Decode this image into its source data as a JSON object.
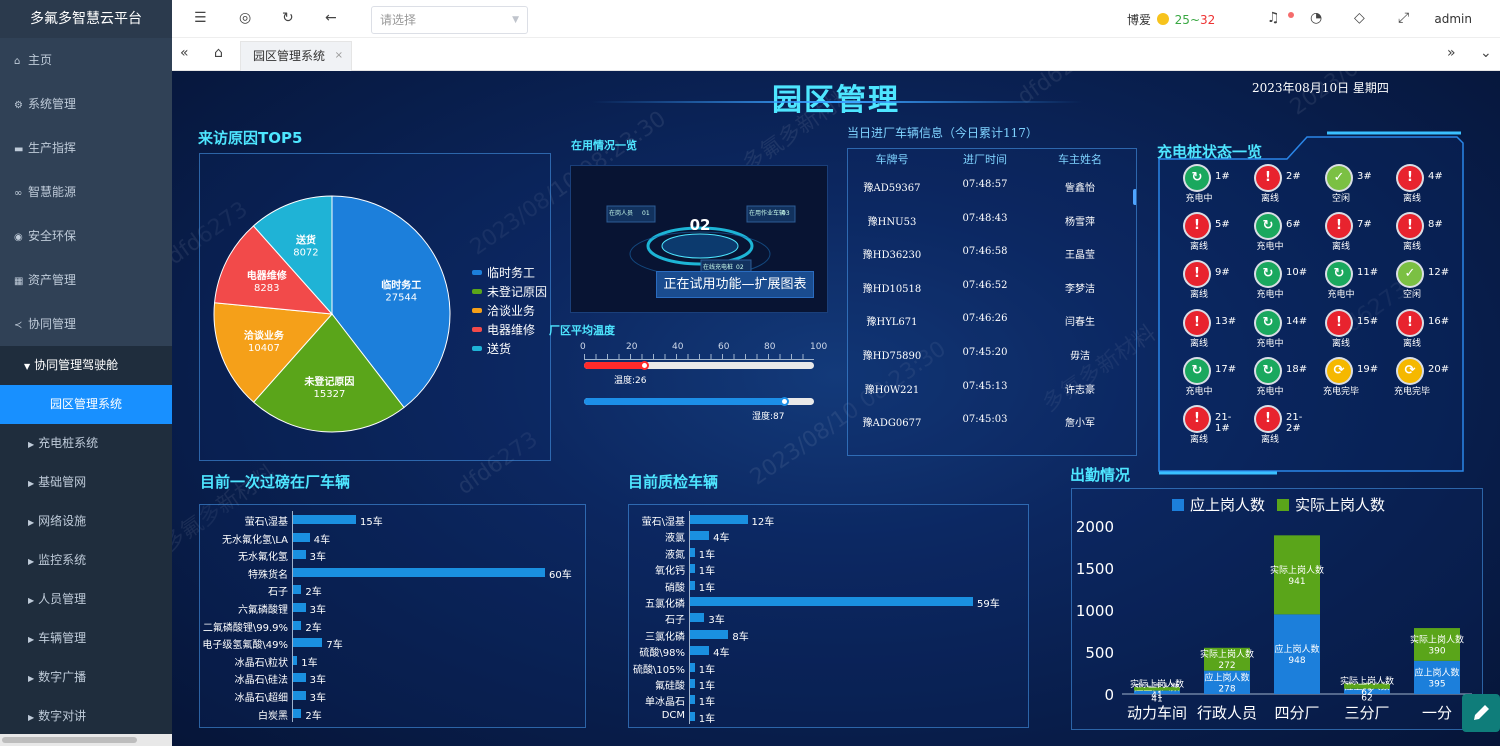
{
  "app": {
    "brand": "多氟多智慧云平台"
  },
  "sidebar": {
    "items": [
      {
        "label": "主页",
        "icon": "⌂"
      },
      {
        "label": "系统管理",
        "icon": "⚙"
      },
      {
        "label": "生产指挥",
        "icon": "▬"
      },
      {
        "label": "智慧能源",
        "icon": "∞"
      },
      {
        "label": "安全环保",
        "icon": "◉"
      },
      {
        "label": "资产管理",
        "icon": "▦"
      },
      {
        "label": "协同管理",
        "icon": "≺"
      }
    ],
    "sub_parent": "协同管理驾驶舱",
    "sub_active": "园区管理系统",
    "sub_items": [
      "充电桩系统",
      "基础管网",
      "网络设施",
      "监控系统",
      "人员管理",
      "车辆管理",
      "数字广播",
      "数字对讲"
    ]
  },
  "header": {
    "select_placeholder": "请选择",
    "weather_city": "博爱",
    "temp_low": "25",
    "temp_sep": "~",
    "temp_high": "32",
    "user": "admin"
  },
  "tabs": {
    "active": "园区管理系统",
    "close": "×"
  },
  "dashboard": {
    "title": "园区管理",
    "date": "2023年08月10日  星期四",
    "watermarks": [
      "dfd6273",
      "2023/08/10 08:23:30",
      "多氟多新材料"
    ]
  },
  "visit_reasons": {
    "title": "来访原因TOP5",
    "chart_data": {
      "type": "pie",
      "slices": [
        {
          "name": "临时务工",
          "value": 27544,
          "color": "#1c7fdb"
        },
        {
          "name": "未登记原因",
          "value": 15327,
          "color": "#5aa51a"
        },
        {
          "name": "洽谈业务",
          "value": 10407,
          "color": "#f5a019"
        },
        {
          "name": "电器维修",
          "value": 8283,
          "color": "#f24a4a"
        },
        {
          "name": "送货",
          "value": 8072,
          "color": "#1fb3d6"
        }
      ],
      "legend_position": "right"
    }
  },
  "usage": {
    "title": "在用情况一览",
    "center_value": "02",
    "monitor_labels": [
      "在岗人员",
      "在用作业车辆",
      "在线充电桩"
    ],
    "monitor_values": [
      "01",
      "03",
      "02"
    ],
    "banner": "正在试用功能—扩展图表"
  },
  "temperature": {
    "title": "厂区平均温度",
    "ticks": [
      "0",
      "20",
      "40",
      "60",
      "80",
      "100"
    ],
    "temp_label": "温度:26",
    "humidity_label": "湿度:87",
    "temp_value": 26,
    "humidity_value": 87
  },
  "vehicles": {
    "title": "当日进厂车辆信息（今日累计117）",
    "columns": [
      "车牌号",
      "进厂时间",
      "车主姓名"
    ],
    "rows": [
      [
        "豫AD59367",
        "07:48:57",
        "訾鑫怡"
      ],
      [
        "豫HNU53",
        "07:48:43",
        "杨雪萍"
      ],
      [
        "豫HD36230",
        "07:46:58",
        "王晶莹"
      ],
      [
        "豫HD10518",
        "07:46:52",
        "李梦洁"
      ],
      [
        "豫HYL671",
        "07:46:26",
        "闫春生"
      ],
      [
        "豫HD75890",
        "07:45:20",
        "毋洁"
      ],
      [
        "豫H0W221",
        "07:45:13",
        "许志豪"
      ],
      [
        "豫ADG0677",
        "07:45:03",
        "詹小军"
      ]
    ]
  },
  "charging": {
    "title": "充电桩状态一览",
    "piles": [
      {
        "num": "1#",
        "status": "充电中",
        "type": "charging"
      },
      {
        "num": "2#",
        "status": "离线",
        "type": "offline"
      },
      {
        "num": "3#",
        "status": "空闲",
        "type": "idle"
      },
      {
        "num": "4#",
        "status": "离线",
        "type": "offline"
      },
      {
        "num": "5#",
        "status": "离线",
        "type": "offline"
      },
      {
        "num": "6#",
        "status": "充电中",
        "type": "charging"
      },
      {
        "num": "7#",
        "status": "离线",
        "type": "offline"
      },
      {
        "num": "8#",
        "status": "离线",
        "type": "offline"
      },
      {
        "num": "9#",
        "status": "离线",
        "type": "offline"
      },
      {
        "num": "10#",
        "status": "充电中",
        "type": "charging"
      },
      {
        "num": "11#",
        "status": "充电中",
        "type": "charging"
      },
      {
        "num": "12#",
        "status": "空闲",
        "type": "idle"
      },
      {
        "num": "13#",
        "status": "离线",
        "type": "offline"
      },
      {
        "num": "14#",
        "status": "充电中",
        "type": "charging"
      },
      {
        "num": "15#",
        "status": "离线",
        "type": "offline"
      },
      {
        "num": "16#",
        "status": "离线",
        "type": "offline"
      },
      {
        "num": "17#",
        "status": "充电中",
        "type": "charging"
      },
      {
        "num": "18#",
        "status": "充电中",
        "type": "charging"
      },
      {
        "num": "19#",
        "status": "充电完毕",
        "type": "done"
      },
      {
        "num": "20#",
        "status": "充电完毕",
        "type": "done"
      },
      {
        "num": "21-1#",
        "status": "离线",
        "type": "offline"
      },
      {
        "num": "21-2#",
        "status": "离线",
        "type": "offline"
      }
    ]
  },
  "weighing": {
    "title": "目前一次过磅在厂车辆",
    "unit": "车",
    "chart_data": {
      "type": "bar",
      "orientation": "horizontal",
      "categories": [
        "萤石\\湿基",
        "无水氟化氢\\LA",
        "无水氟化氢",
        "特殊货名",
        "石子",
        "六氟磷酸锂",
        "二氟磷酸锂\\99.9%",
        "电子级氢氟酸\\49%",
        "冰晶石\\粒状",
        "冰晶石\\硅法",
        "冰晶石\\超细",
        "白炭黑"
      ],
      "values": [
        15,
        4,
        3,
        60,
        2,
        3,
        2,
        7,
        1,
        3,
        3,
        2
      ],
      "xlim": [
        0,
        60
      ]
    }
  },
  "inspection": {
    "title": "目前质检车辆",
    "unit": "车",
    "chart_data": {
      "type": "bar",
      "orientation": "horizontal",
      "categories": [
        "萤石\\湿基",
        "液氯",
        "液氮",
        "氧化钙",
        "硝酸",
        "五氯化磷",
        "石子",
        "三氯化磷",
        "硫酸\\98%",
        "硫酸\\105%",
        "氟硅酸",
        "单冰晶石",
        "DCM"
      ],
      "values": [
        12,
        4,
        1,
        1,
        1,
        59,
        3,
        8,
        4,
        1,
        1,
        1,
        1
      ],
      "xlim": [
        0,
        59
      ]
    }
  },
  "attendance": {
    "title": "出勤情况",
    "chart_data": {
      "type": "bar",
      "stacked": true,
      "categories": [
        "动力车间",
        "行政人员",
        "四分厂",
        "三分厂",
        "一分"
      ],
      "series": [
        {
          "name": "应上岗人数",
          "color": "#1c7fdb",
          "values": [
            41,
            278,
            948,
            62,
            395
          ]
        },
        {
          "name": "实际上岗人数",
          "color": "#5aa51a",
          "values": [
            41,
            272,
            941,
            62,
            390
          ]
        }
      ],
      "ylim": [
        0,
        2000
      ],
      "yticks": [
        "0",
        "500",
        "1000",
        "1500",
        "2000"
      ],
      "legend_position": "top"
    }
  }
}
